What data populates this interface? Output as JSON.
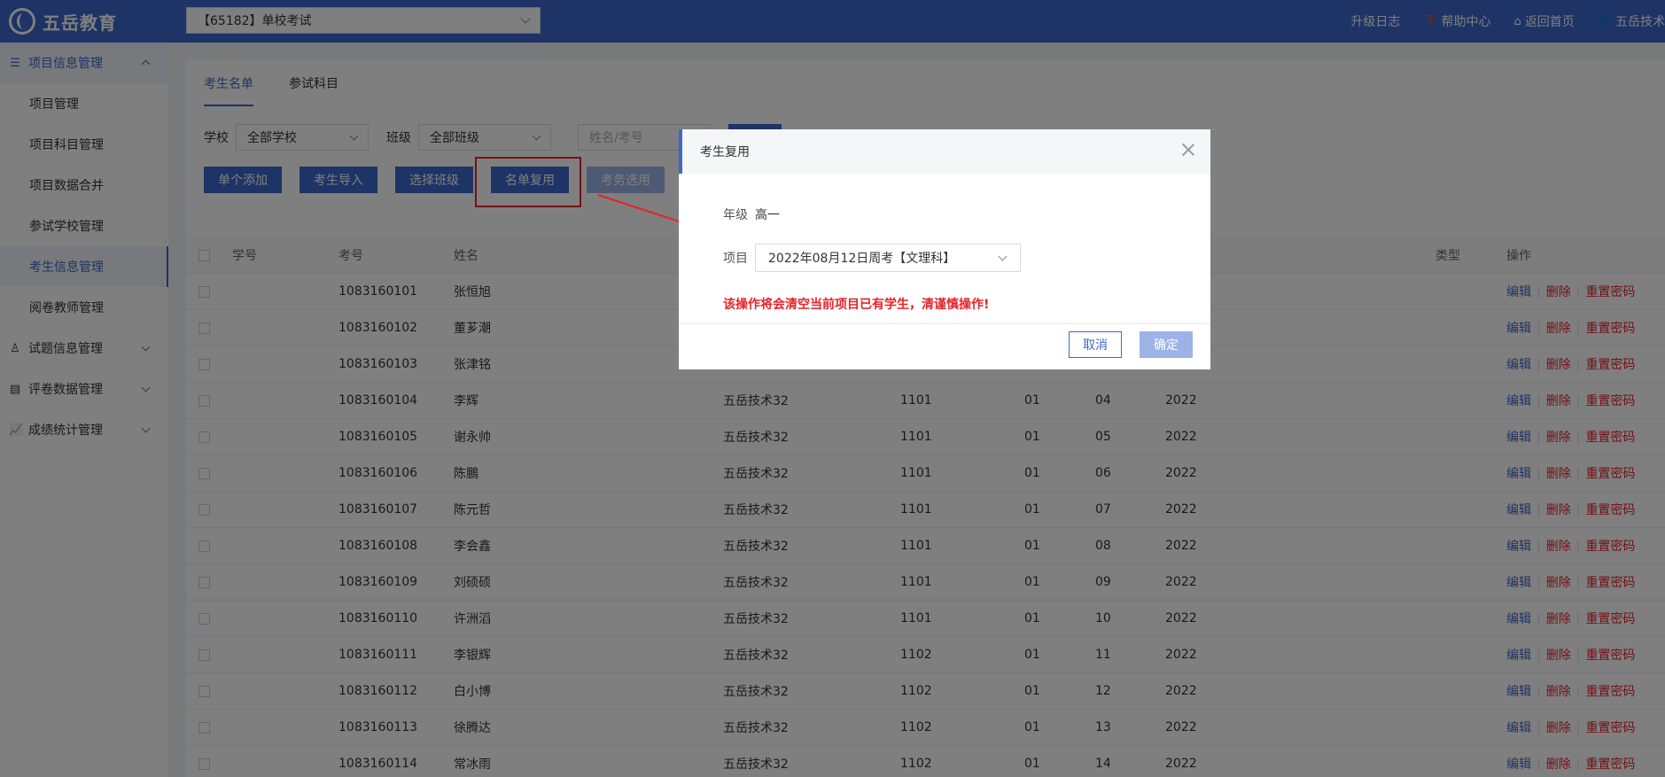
{
  "brand": {
    "name": "五岳教育"
  },
  "header": {
    "project_select": "【65182】单校考试",
    "links": [
      {
        "label": "升级日志",
        "icon": ""
      },
      {
        "label": "帮助中心",
        "icon": "help-circle-icon"
      },
      {
        "label": "返回首页",
        "icon": "home-icon"
      },
      {
        "label": "五岳技术",
        "icon": "user-icon"
      }
    ]
  },
  "sidebar": {
    "groups": [
      {
        "label": "项目信息管理",
        "icon": "database-icon",
        "expanded": true,
        "items": [
          "项目管理",
          "项目科目管理",
          "项目数据合并",
          "参试学校管理",
          "考生信息管理",
          "阅卷教师管理"
        ]
      },
      {
        "label": "试题信息管理",
        "icon": "user-icon"
      },
      {
        "label": "评卷数据管理",
        "icon": "list-icon"
      },
      {
        "label": "成绩统计管理",
        "icon": "chart-icon"
      }
    ],
    "active_item": "考生信息管理"
  },
  "tabs": [
    "考生名单",
    "参试科目"
  ],
  "filters": {
    "school_label": "学校",
    "school_value": "全部学校",
    "class_label": "班级",
    "class_value": "全部班级",
    "search_placeholder": "姓名/考号"
  },
  "actions": [
    "单个添加",
    "考生导入",
    "选择班级",
    "名单复用",
    "考务选用"
  ],
  "table": {
    "headers": {
      "xh": "学号",
      "kh": "考号",
      "xm": "姓名",
      "type": "类型",
      "op": "操作"
    },
    "ops": {
      "edit": "编辑",
      "delete": "删除",
      "reset": "重置密码"
    },
    "rows": [
      {
        "kh": "1083160101",
        "xm": "张恒旭",
        "school": "",
        "cls": "",
        "a": "",
        "b": "",
        "yr": ""
      },
      {
        "kh": "1083160102",
        "xm": "董芗潮",
        "school": "",
        "cls": "",
        "a": "",
        "b": "",
        "yr": ""
      },
      {
        "kh": "1083160103",
        "xm": "张津铭",
        "school": "",
        "cls": "",
        "a": "",
        "b": "",
        "yr": ""
      },
      {
        "kh": "1083160104",
        "xm": "李辉",
        "school": "五岳技术32",
        "cls": "1101",
        "a": "01",
        "b": "04",
        "yr": "2022"
      },
      {
        "kh": "1083160105",
        "xm": "谢永帅",
        "school": "五岳技术32",
        "cls": "1101",
        "a": "01",
        "b": "05",
        "yr": "2022"
      },
      {
        "kh": "1083160106",
        "xm": "陈鵬",
        "school": "五岳技术32",
        "cls": "1101",
        "a": "01",
        "b": "06",
        "yr": "2022"
      },
      {
        "kh": "1083160107",
        "xm": "陈元哲",
        "school": "五岳技术32",
        "cls": "1101",
        "a": "01",
        "b": "07",
        "yr": "2022"
      },
      {
        "kh": "1083160108",
        "xm": "李会鑫",
        "school": "五岳技术32",
        "cls": "1101",
        "a": "01",
        "b": "08",
        "yr": "2022"
      },
      {
        "kh": "1083160109",
        "xm": "刘硕硕",
        "school": "五岳技术32",
        "cls": "1101",
        "a": "01",
        "b": "09",
        "yr": "2022"
      },
      {
        "kh": "1083160110",
        "xm": "许洲滔",
        "school": "五岳技术32",
        "cls": "1101",
        "a": "01",
        "b": "10",
        "yr": "2022"
      },
      {
        "kh": "1083160111",
        "xm": "李银辉",
        "school": "五岳技术32",
        "cls": "1102",
        "a": "01",
        "b": "11",
        "yr": "2022"
      },
      {
        "kh": "1083160112",
        "xm": "白小博",
        "school": "五岳技术32",
        "cls": "1102",
        "a": "01",
        "b": "12",
        "yr": "2022"
      },
      {
        "kh": "1083160113",
        "xm": "徐腾达",
        "school": "五岳技术32",
        "cls": "1102",
        "a": "01",
        "b": "13",
        "yr": "2022"
      },
      {
        "kh": "1083160114",
        "xm": "常冰雨",
        "school": "五岳技术32",
        "cls": "1102",
        "a": "01",
        "b": "14",
        "yr": "2022"
      }
    ]
  },
  "modal": {
    "title": "考生复用",
    "grade_label": "年级",
    "grade_value": "高一",
    "project_label": "项目",
    "project_value": "2022年08月12日周考【文理科】",
    "warning": "该操作将会清空当前项目已有学生，清谨慎操作!",
    "cancel": "取消",
    "confirm": "确定"
  },
  "colors": {
    "primary": "#3c67cc",
    "danger": "#e8222b",
    "disabled": "#9db2e6"
  }
}
